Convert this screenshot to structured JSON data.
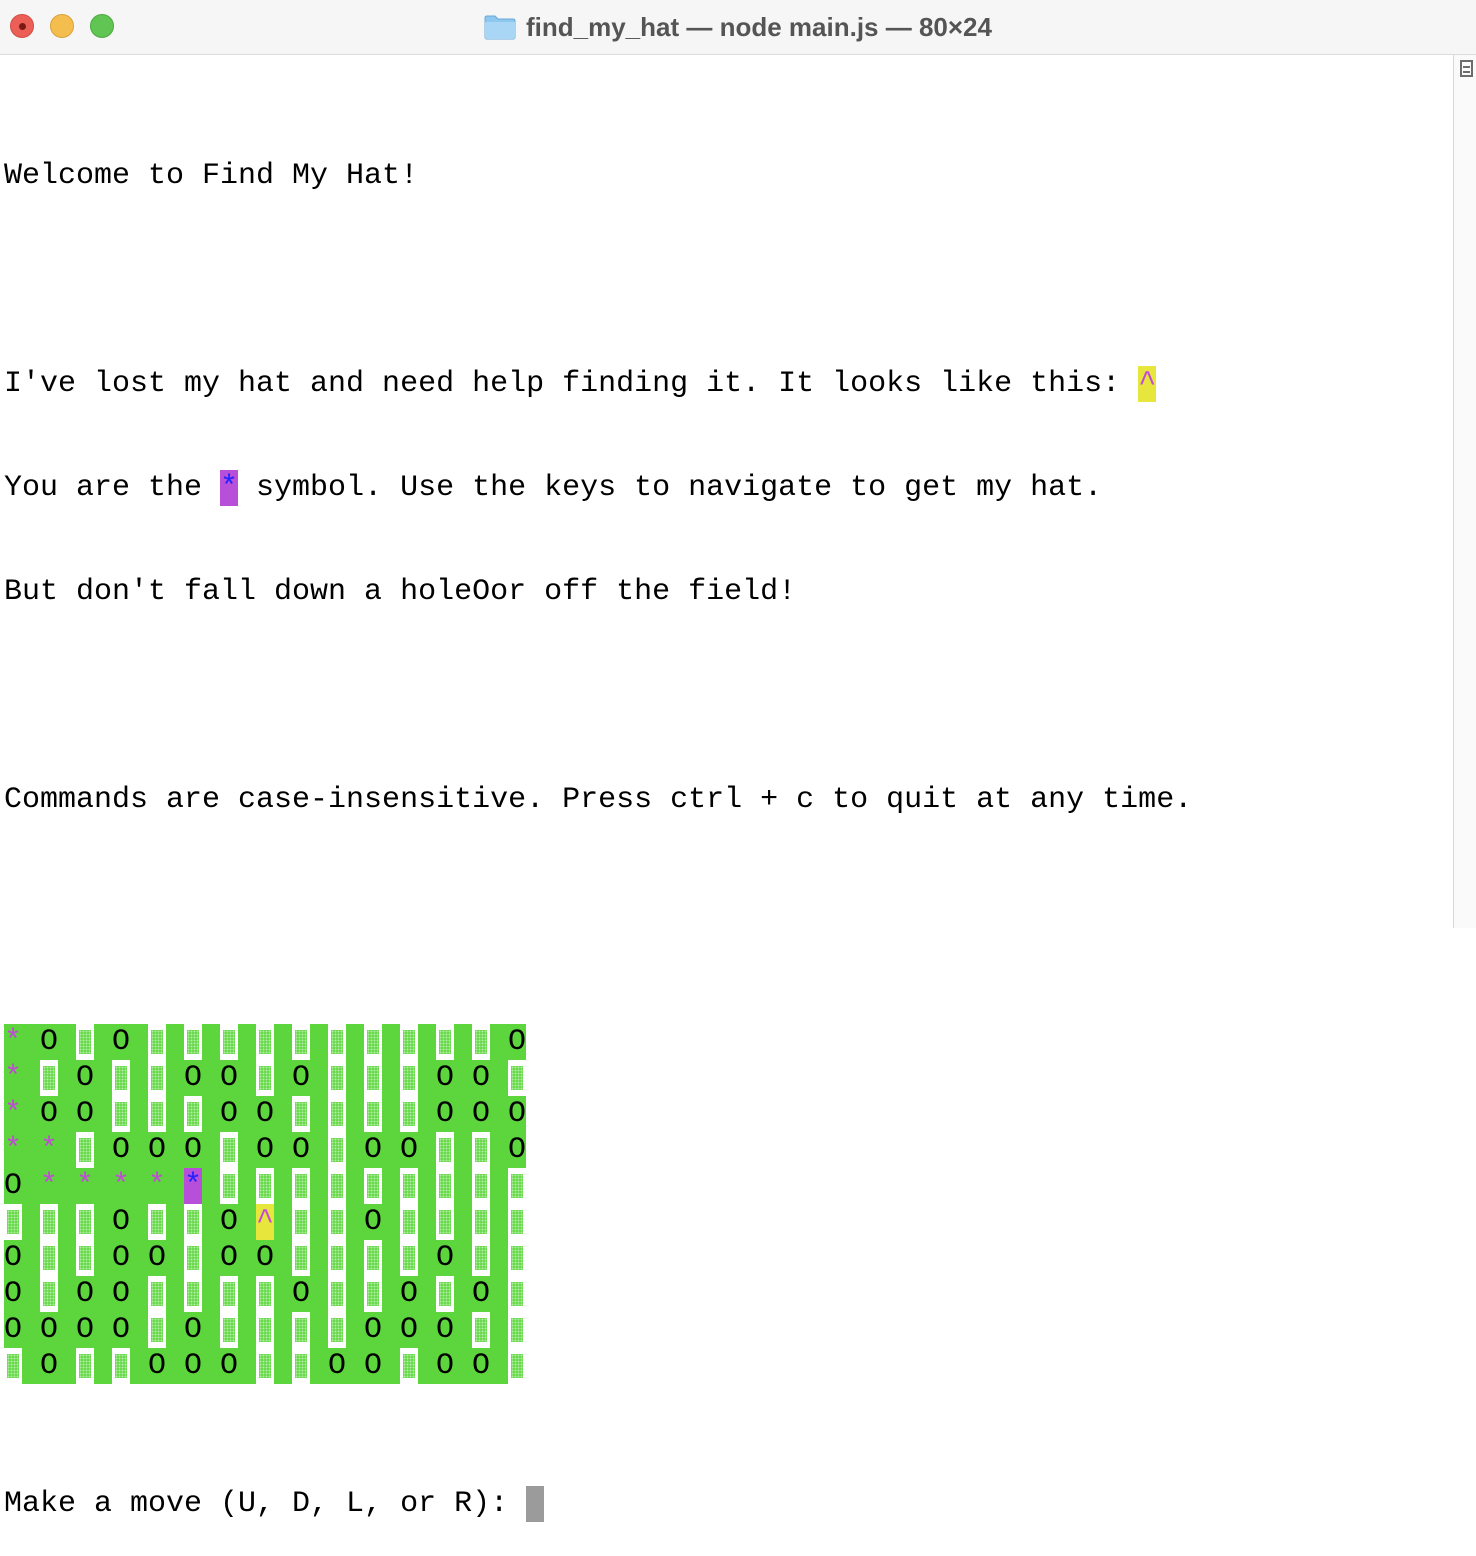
{
  "window": {
    "title": "find_my_hat — node main.js — 80×24",
    "icon": "folder-icon"
  },
  "terminal": {
    "welcome": "Welcome to Find My Hat!",
    "intro1_prefix": "I've lost my hat and need help finding it. It looks like this: ",
    "intro1_hat": "^",
    "intro2_prefix": "You are the ",
    "intro2_player": "*",
    "intro2_suffix": " symbol. Use the keys to navigate to get my hat.",
    "intro3": "But don't fall down a holeOor off the field!",
    "commands": "Commands are case-insensitive. Press ctrl + c to quit at any time.",
    "prompt": "Make a move (U, D, L, or R): "
  },
  "field": {
    "legend": {
      "hole": "O",
      "path": "*",
      "hat": "^",
      "player": "*",
      "field": "░"
    },
    "rows": [
      "*O░O░░░░░░░░░░",
      "*░O░░OO░O░░░OO",
      "*OO░░░OO░░░░OO",
      "**░OOO░OO░OO░░",
      "O****P░░░░░░░░",
      "░░░O░░O^░░O░░░",
      "O░░OO░OO░░░░O░",
      "O░OO░░░░O░░O░O",
      "OOOO░O░░░░OOO░",
      "░O░░OOO░░OO░OO"
    ],
    "rows_full": [
      "*O░O░░░░░░░░░░O",
      "*░O░░OO░O░░░OO░",
      "*OO░░░OO░░░░OOO",
      "**░OOO░OO░OO░░O",
      "O****P░░░░░░░░░",
      "░░░O░░O^░░O░░░░",
      "O░░OO░OO░░░░O░░",
      "O░OO░░░░O░░O░O░",
      "OOOO░O░░░░OOO░░",
      "░O░░OOO░░OO░OO░"
    ]
  },
  "colors": {
    "field_bg": "#5cd63c",
    "hat_bg": "#e6e63c",
    "player_bg": "#b84fd8",
    "path_fg": "#c24ad6",
    "player_fg": "#2222ff"
  }
}
